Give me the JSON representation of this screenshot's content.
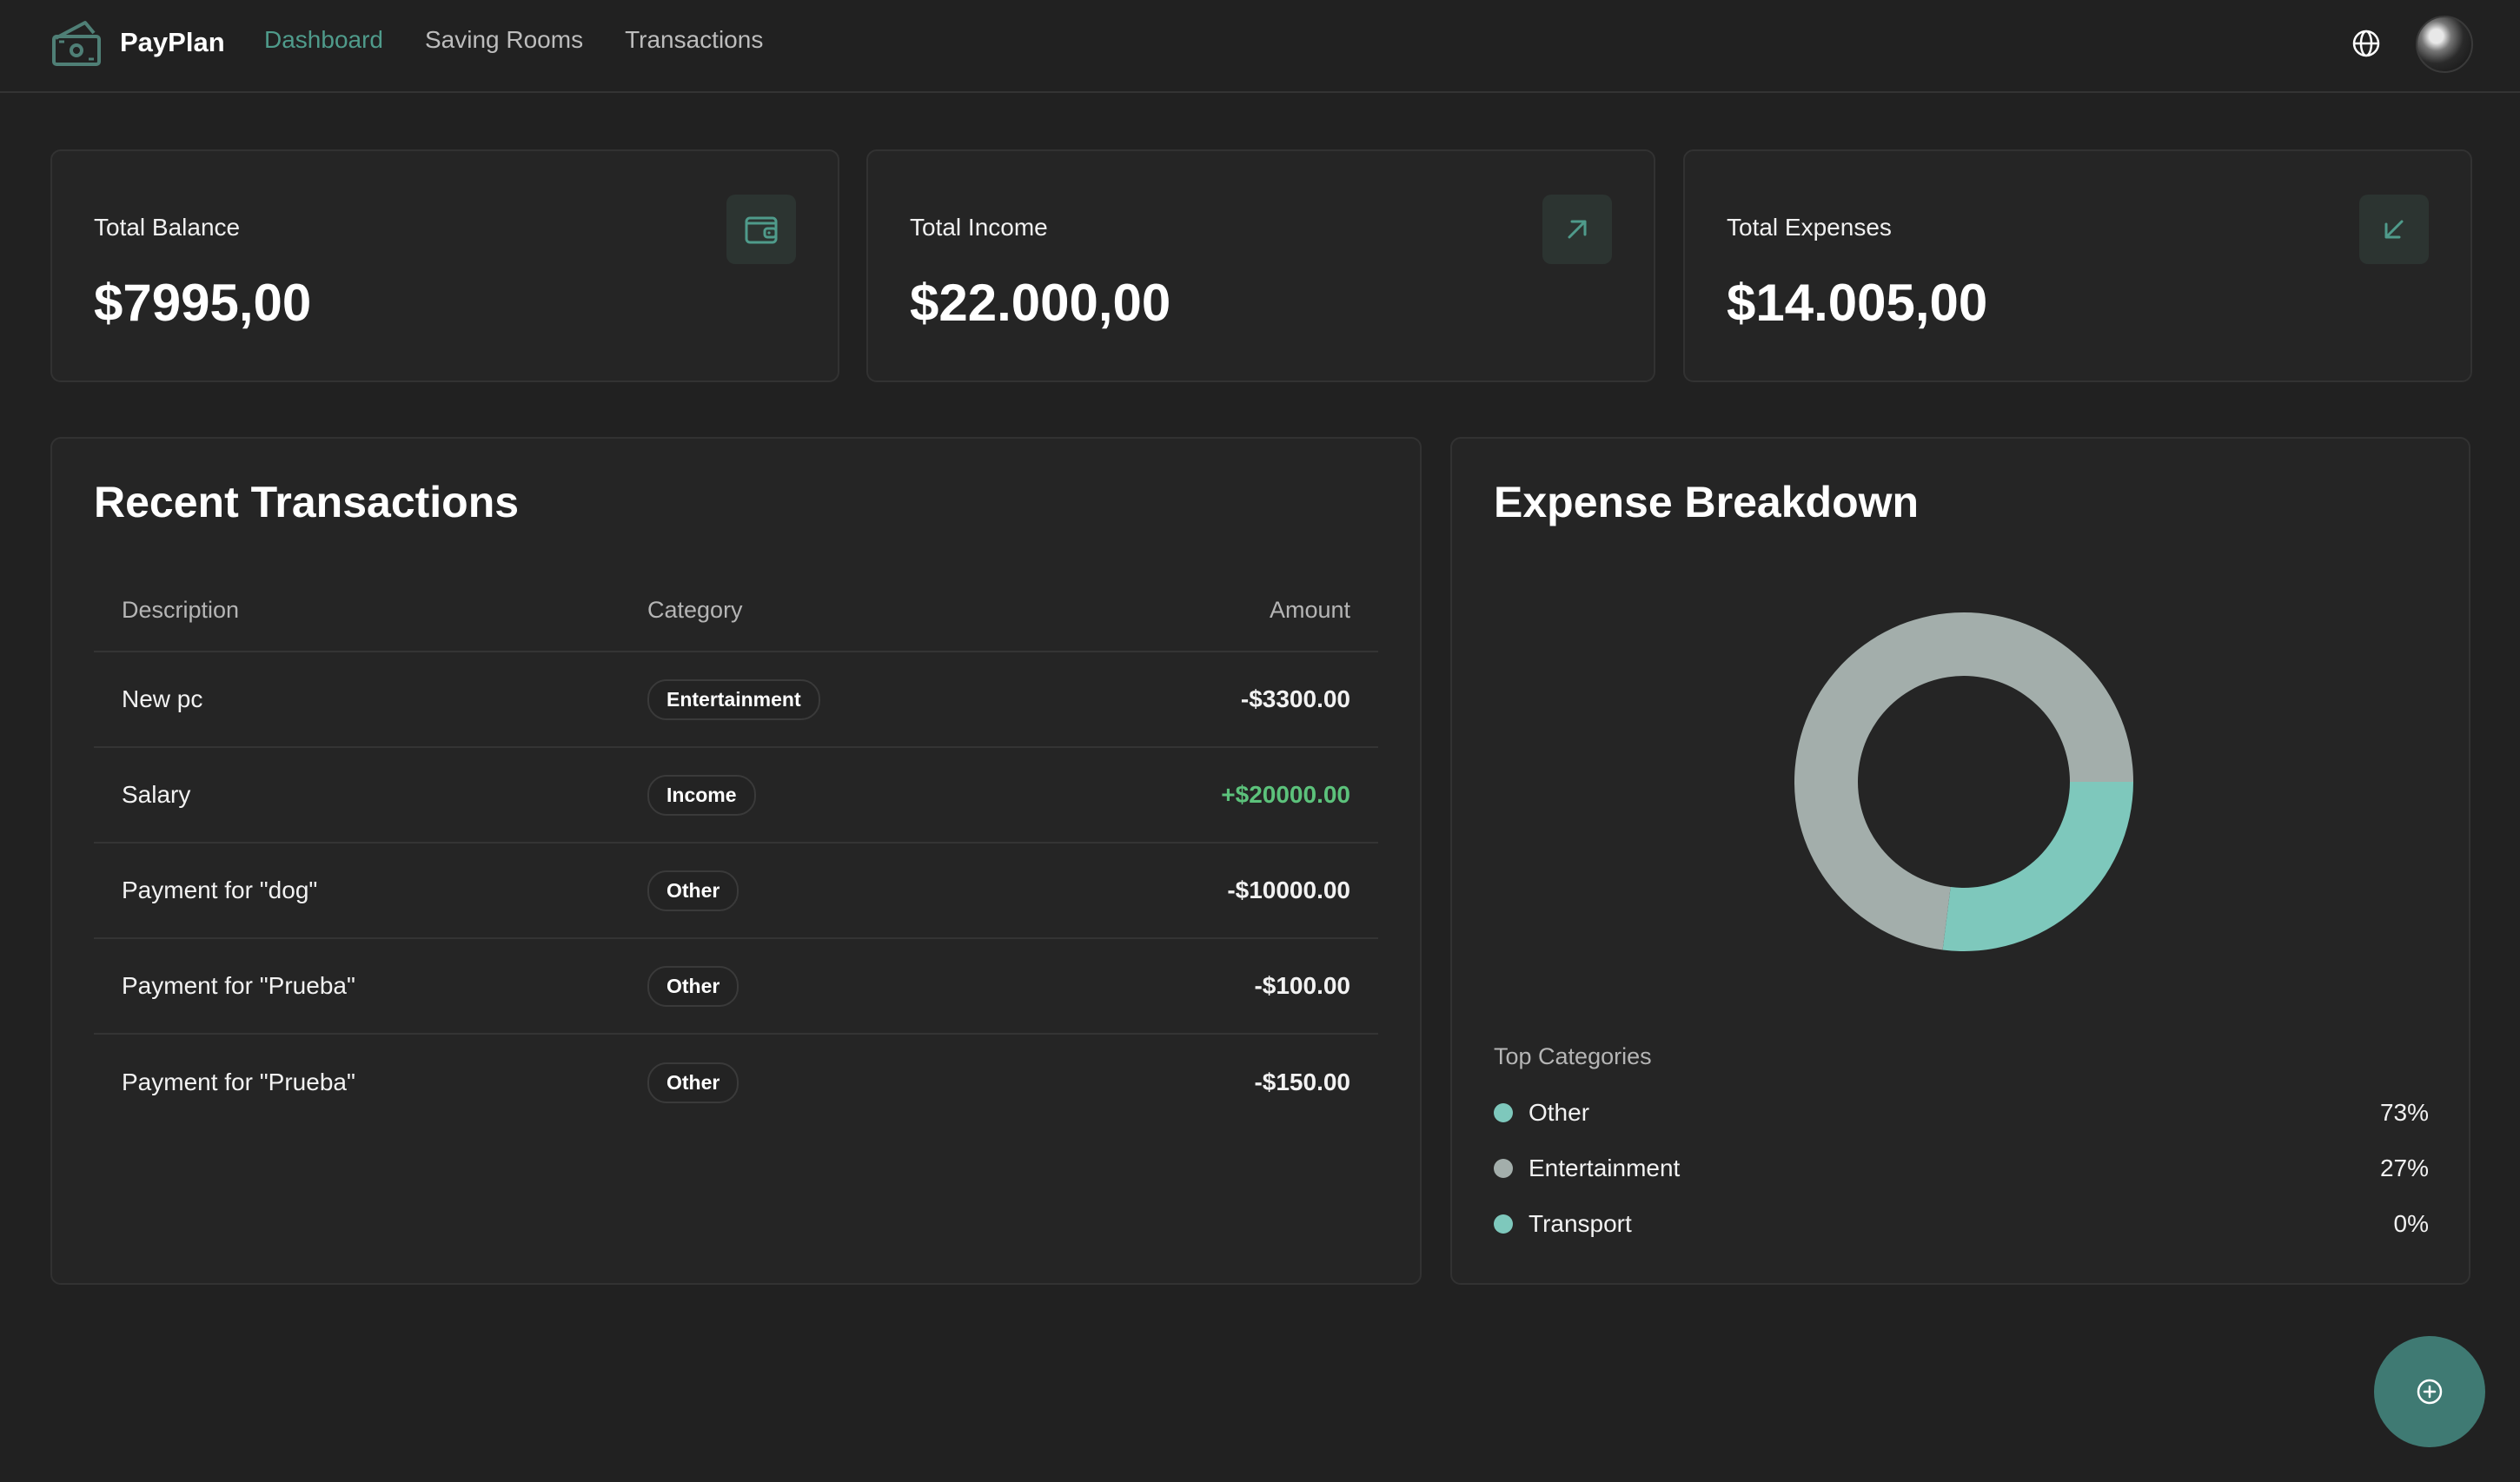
{
  "app": {
    "name": "PayPlan"
  },
  "nav": {
    "links": [
      {
        "label": "Dashboard",
        "active": true
      },
      {
        "label": "Saving Rooms",
        "active": false
      },
      {
        "label": "Transactions",
        "active": false
      }
    ],
    "globe_icon": "globe-icon",
    "avatar_icon": "user-avatar"
  },
  "stats": [
    {
      "label": "Total Balance",
      "value": "$7995,00",
      "icon": "wallet-icon"
    },
    {
      "label": "Total Income",
      "value": "$22.000,00",
      "icon": "arrow-up-right-icon"
    },
    {
      "label": "Total Expenses",
      "value": "$14.005,00",
      "icon": "arrow-down-left-icon"
    }
  ],
  "transactions": {
    "title": "Recent Transactions",
    "headers": {
      "description": "Description",
      "category": "Category",
      "amount": "Amount"
    },
    "rows": [
      {
        "description": "New pc",
        "category": "Entertainment",
        "amount": "-$3300.00",
        "positive": false
      },
      {
        "description": "Salary",
        "category": "Income",
        "amount": "+$20000.00",
        "positive": true
      },
      {
        "description": "Payment for \"dog\"",
        "category": "Other",
        "amount": "-$10000.00",
        "positive": false
      },
      {
        "description": "Payment for \"Prueba\"",
        "category": "Other",
        "amount": "-$100.00",
        "positive": false
      },
      {
        "description": "Payment for \"Prueba\"",
        "category": "Other",
        "amount": "-$150.00",
        "positive": false
      }
    ]
  },
  "breakdown": {
    "title": "Expense Breakdown",
    "top_categories_label": "Top Categories",
    "legend": [
      {
        "name": "Other",
        "percent": "73%",
        "color": "#7ec8bc"
      },
      {
        "name": "Entertainment",
        "percent": "27%",
        "color": "#a3aeab"
      },
      {
        "name": "Transport",
        "percent": "0%",
        "color": "#7ec8bc"
      }
    ]
  },
  "chart_data": {
    "type": "pie",
    "categories": [
      "Other",
      "Entertainment",
      "Transport"
    ],
    "values": [
      73,
      27,
      0
    ],
    "colors": [
      "#a3aeab",
      "#7ec8bc",
      "#7ec8bc"
    ],
    "title": "Expense Breakdown"
  },
  "fab": {
    "icon": "plus-circle-icon"
  },
  "colors": {
    "accent": "#4f9b8b",
    "positive": "#5cc27b",
    "background": "#212121",
    "card": "#252525"
  }
}
